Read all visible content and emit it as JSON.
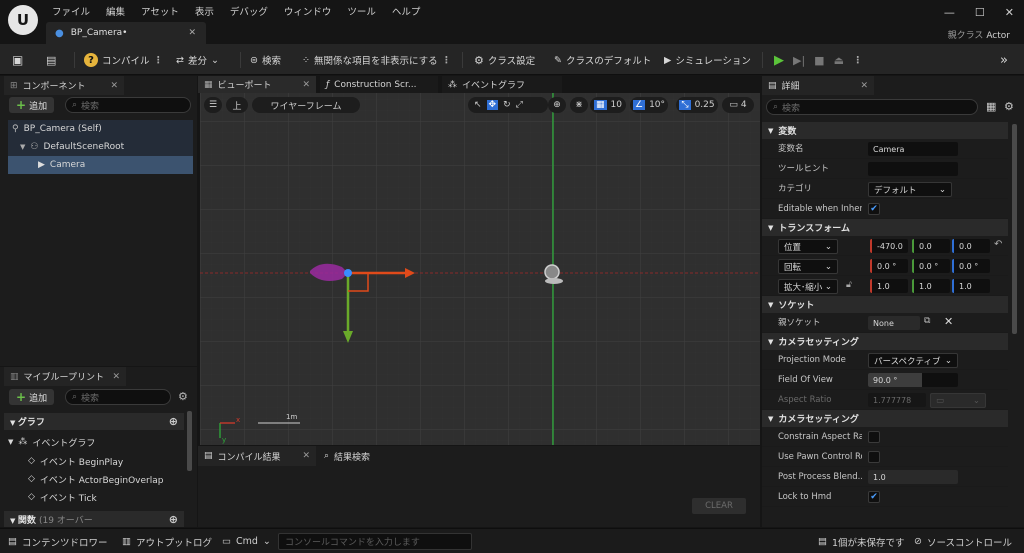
{
  "menu": [
    "ファイル",
    "編集",
    "アセット",
    "表示",
    "デバッグ",
    "ウィンドウ",
    "ツール",
    "ヘルプ"
  ],
  "tab": {
    "title": "BP_Camera•"
  },
  "window": {
    "parent_label": "親クラス",
    "parent_value": "Actor"
  },
  "toolbar": {
    "compile": "コンパイル",
    "diff": "差分",
    "find": "検索",
    "hide": "無関係な項目を非表示にする",
    "class_settings": "クラス設定",
    "class_defaults": "クラスのデフォルト",
    "simulation": "シミュレーション"
  },
  "components": {
    "tab": "コンポーネント",
    "add": "追加",
    "search_placeholder": "検索",
    "items": [
      "BP_Camera (Self)",
      "DefaultSceneRoot",
      "Camera"
    ]
  },
  "myblueprint": {
    "tab": "マイブループリント",
    "add": "追加",
    "search_placeholder": "検索",
    "graph_header": "グラフ",
    "event_graph": "イベントグラフ",
    "events": [
      "イベント BeginPlay",
      "イベント ActorBeginOverlap",
      "イベント Tick"
    ],
    "functions_header": "関数",
    "functions_count": "(19 オーバー"
  },
  "editor_tabs": [
    "ビューポート",
    "Construction Scr...",
    "イベントグラフ"
  ],
  "viewport": {
    "up_label": "上",
    "view_mode": "ワイヤーフレーム",
    "grid_snap": "10",
    "rot_snap": "10°",
    "scale_snap": "0.25",
    "cam_speed": "4",
    "scale_label": "1m"
  },
  "bottom_tabs": [
    "コンパイル結果",
    "結果検索"
  ],
  "compile": {
    "clear": "CLEAR"
  },
  "details": {
    "tab": "詳細",
    "search_placeholder": "検索",
    "sec_vars": "変数",
    "var_name_label": "変数名",
    "var_name_value": "Camera",
    "tooltip_label": "ツールヒント",
    "tooltip_value": "",
    "category_label": "カテゴリ",
    "category_value": "デフォルト",
    "editable_label": "Editable when Inherit...",
    "sec_transform": "トランスフォーム",
    "location": "位置",
    "rotation": "回転",
    "scale": "拡大･縮小",
    "loc": [
      "-470.0",
      "0.0",
      "0.0"
    ],
    "rot": [
      "0.0 °",
      "0.0 °",
      "0.0 °"
    ],
    "scl": [
      "1.0",
      "1.0",
      "1.0"
    ],
    "sec_socket": "ソケット",
    "parent_socket_label": "親ソケット",
    "parent_socket_value": "None",
    "sec_camera": "カメラセッティング",
    "projection_label": "Projection Mode",
    "projection_value": "パースペクティブ",
    "fov_label": "Field Of View",
    "fov_value": "90.0 °",
    "fov_fill": 0.6,
    "aspect_label": "Aspect Ratio",
    "aspect_value": "1.777778",
    "sec_camera2": "カメラセッティング",
    "constrain_label": "Constrain Aspect Ra...",
    "pawn_label": "Use Pawn Control Ro...",
    "ppb_label": "Post Process Blend...",
    "ppb_value": "1.0",
    "lock_label": "Lock to Hmd"
  },
  "status": {
    "content_drawer": "コンテンツドロワー",
    "output_log": "アウトプットログ",
    "cmd": "Cmd",
    "cmd_placeholder": "コンソールコマンドを入力します",
    "unsaved": "1個が未保存です",
    "source_control": "ソースコントロール"
  }
}
